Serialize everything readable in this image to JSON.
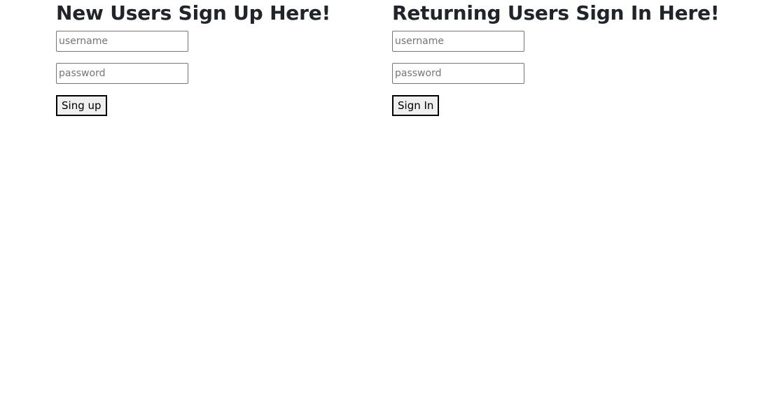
{
  "signup": {
    "title": "New Users Sign Up Here!",
    "username_placeholder": "username",
    "username_value": "",
    "password_placeholder": "password",
    "password_value": "",
    "button_label": "Sing up"
  },
  "signin": {
    "title": "Returning Users Sign In Here!",
    "username_placeholder": "username",
    "username_value": "",
    "password_placeholder": "password",
    "password_value": "",
    "button_label": "Sign In"
  }
}
